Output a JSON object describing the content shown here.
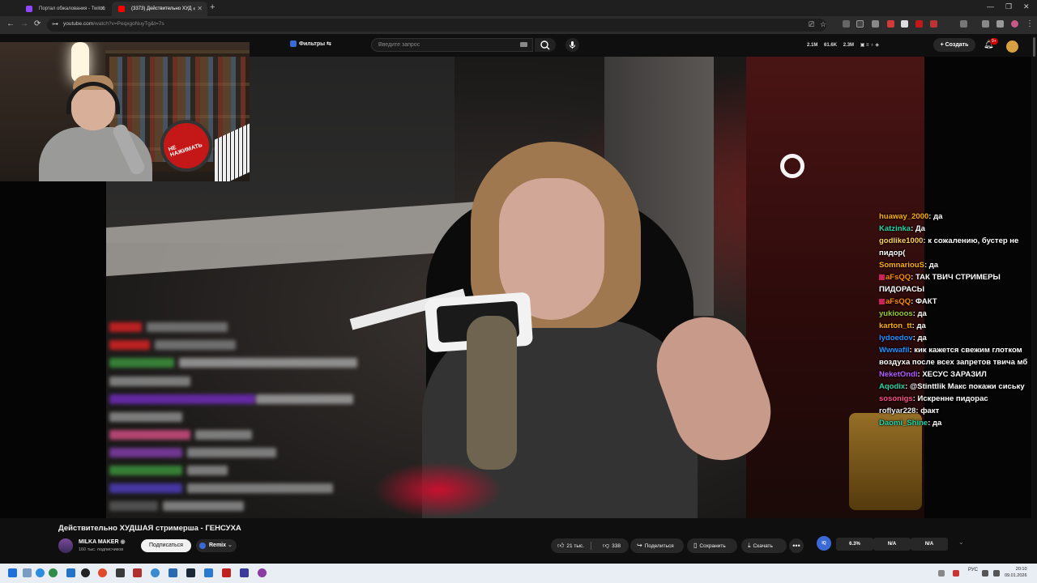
{
  "browser": {
    "tabs": [
      {
        "title": "Портал обжалования - Twitch",
        "favicon_color": "#9146ff"
      },
      {
        "title": "(3373) Действительно ХУД",
        "favicon_color": "#ff0000",
        "audio_icon": "speaker-icon"
      }
    ],
    "new_tab": "+",
    "window_controls": {
      "minimize": "—",
      "restore": "❐",
      "close": "✕"
    },
    "nav": {
      "back": "←",
      "forward": "→",
      "reload": "⟳"
    },
    "url_host": "youtube.com",
    "url_path": "/watch?v=PeqxgoNuyTg&t=7s"
  },
  "youtube": {
    "filters_label": "Фильтры",
    "search_placeholder": "Введите запрос",
    "header_stats": [
      "2.1M",
      "61.6K",
      "2.3M"
    ],
    "create_label": "Создать",
    "notifications_badge": "9+"
  },
  "webcam": {
    "red_button_text": "НЕ НАЖИМАТЬ"
  },
  "chat": [
    {
      "user": "huaway_2000",
      "color": "#ffb000",
      "text": "да"
    },
    {
      "user": "Katzinka",
      "color": "#22d6a8",
      "text": "Да"
    },
    {
      "user": "godlike1000",
      "color": "#ffd15a",
      "text": "к сожалению, бустер не пидор("
    },
    {
      "user": "SomnariouS",
      "color": "#ffb000",
      "text": "да"
    },
    {
      "user": "aFsQQ",
      "color": "#ff8c00",
      "badge": true,
      "text": "ТАК ТВИЧ СТРИМЕРЫ ПИДОРАСЫ"
    },
    {
      "user": "aFsQQ",
      "color": "#ff8c00",
      "badge": true,
      "text": "ФАКТ"
    },
    {
      "user": "yukiooos",
      "color": "#9acd32",
      "text": "да"
    },
    {
      "user": "karton_tt",
      "color": "#ffb000",
      "text": "да"
    },
    {
      "user": "lydoedov",
      "color": "#1e90ff",
      "text": "да"
    },
    {
      "user": "Wwwafil",
      "color": "#1e90ff",
      "text": "кик кажется свежим глотком воздуха после всех запретов твича мб"
    },
    {
      "user": "NeketOndi",
      "color": "#b45cff",
      "text": "ХЕСУС ЗАРАЗИЛ"
    },
    {
      "user": "Aqodix",
      "color": "#22d6a8",
      "text": "@Stinttlik Макс покажи сиську"
    },
    {
      "user": "sosonigs",
      "color": "#ff4f8b",
      "text": "Искренне пидорас"
    },
    {
      "user": "roflyar228",
      "color": "#f0f0f0",
      "text": "факт"
    },
    {
      "user": "Daomi_Shine",
      "color": "#22d6a8",
      "text": "да"
    }
  ],
  "video": {
    "title": "Действительно ХУДШАЯ стримерша - ГЕНСУХА",
    "channel": "MILKA MAKER",
    "subscribers": "160 тыс. подписчиков",
    "subscribe_label": "Подписаться",
    "remix_label": "Remix",
    "likes": "21 тыс.",
    "dislikes": "338",
    "share_label": "Поделиться",
    "save_label": "Сохранить",
    "download_label": "Скачать",
    "more_label": "•••"
  },
  "extension": {
    "logo": "IQ",
    "values": [
      "6.3%",
      "N/A",
      "N/A"
    ]
  },
  "taskbar": {
    "language": "РУС",
    "time": "20:10",
    "date": "09.01.2026"
  }
}
